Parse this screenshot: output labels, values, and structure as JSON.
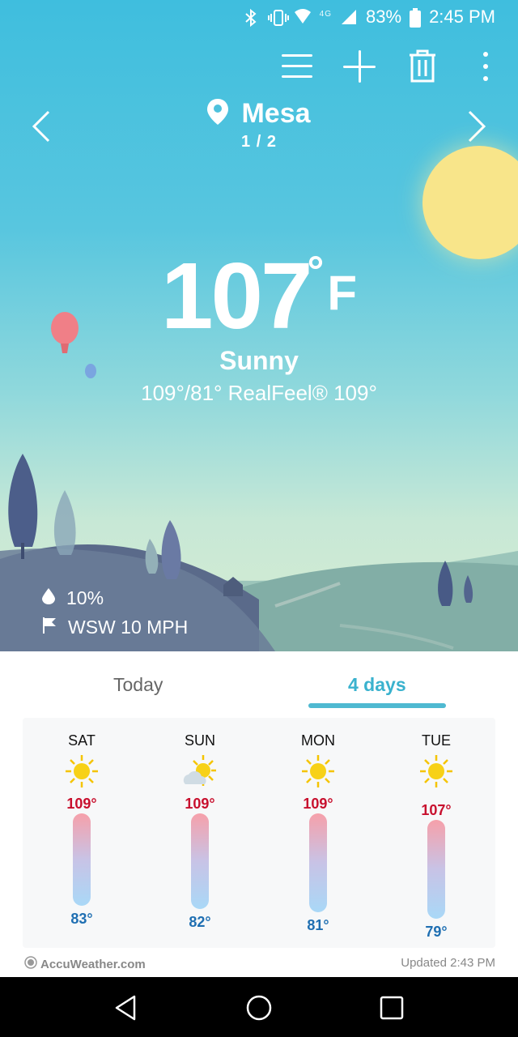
{
  "status_bar": {
    "network": "4G",
    "battery": "83%",
    "time": "2:45 PM"
  },
  "toolbar": {
    "menu_icon": "menu-icon",
    "add_icon": "plus-icon",
    "delete_icon": "trash-icon",
    "more_icon": "more-vert-icon"
  },
  "location": {
    "city": "Mesa",
    "page": "1 / 2"
  },
  "current": {
    "temp": "107",
    "unit": "F",
    "condition": "Sunny",
    "hilo": "109°/81° RealFeel® 109°",
    "precip": "10%",
    "wind": "WSW 10 MPH"
  },
  "tabs": {
    "today": "Today",
    "four_days": "4 days",
    "selected": "4 days"
  },
  "forecast": [
    {
      "day": "SAT",
      "icon": "sun-icon",
      "high": "109°",
      "low": "83°"
    },
    {
      "day": "SUN",
      "icon": "sun-cloud-icon",
      "high": "109°",
      "low": "82°"
    },
    {
      "day": "MON",
      "icon": "sun-icon",
      "high": "109°",
      "low": "81°"
    },
    {
      "day": "TUE",
      "icon": "sun-icon",
      "high": "107°",
      "low": "79°"
    }
  ],
  "footer": {
    "brand": "AccuWeather.com",
    "updated": "Updated 2:43 PM"
  },
  "colors": {
    "high": "#c8102e",
    "low": "#1f6fb2",
    "accent": "#3ab2ce"
  }
}
